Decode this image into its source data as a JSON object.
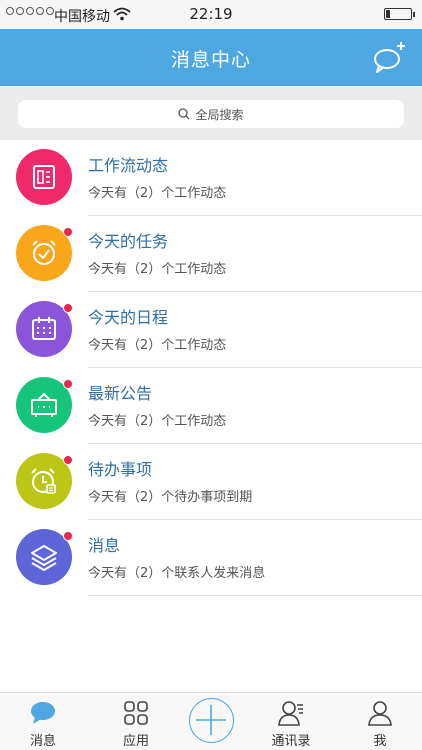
{
  "status_bar": {
    "carrier": "中国移动",
    "time": "22:19",
    "battery_level": 0.15
  },
  "header": {
    "title": "消息中心",
    "compose_icon": "chat-bubble-plus-icon"
  },
  "search": {
    "label": "全局搜索",
    "icon": "search-icon"
  },
  "items": [
    {
      "title": "工作流动态",
      "subtitle": "今天有（2）个工作动态",
      "color": "#f0296b",
      "icon": "document-icon",
      "unread": false
    },
    {
      "title": "今天的任务",
      "subtitle": "今天有（2）个工作动态",
      "color": "#f9a61a",
      "icon": "alarm-clock-check-icon",
      "unread": true
    },
    {
      "title": "今天的日程",
      "subtitle": "今天有（2）个工作动态",
      "color": "#8a55d9",
      "icon": "calendar-icon",
      "unread": true
    },
    {
      "title": "最新公告",
      "subtitle": "今天有（2）个工作动态",
      "color": "#17c57a",
      "icon": "announcement-board-icon",
      "unread": true
    },
    {
      "title": "待办事项",
      "subtitle": "今天有（2）个待办事项到期",
      "color": "#bcc617",
      "icon": "alarm-clock-list-icon",
      "unread": true
    },
    {
      "title": "消息",
      "subtitle": "今天有（2）个联系人发来消息",
      "color": "#5d65d8",
      "icon": "layers-icon",
      "unread": true
    }
  ],
  "tabs": [
    {
      "label": "消息",
      "icon": "chat-bubble-icon",
      "active": true
    },
    {
      "label": "应用",
      "icon": "grid-icon",
      "active": false
    },
    {
      "label": "",
      "icon": "plus-circle-icon",
      "active": false
    },
    {
      "label": "通讯录",
      "icon": "contacts-icon",
      "active": false
    },
    {
      "label": "我",
      "icon": "person-icon",
      "active": false
    }
  ],
  "colors": {
    "accent": "#4fa7e2",
    "title_text": "#2f6fa5",
    "badge": "#e8264a"
  }
}
